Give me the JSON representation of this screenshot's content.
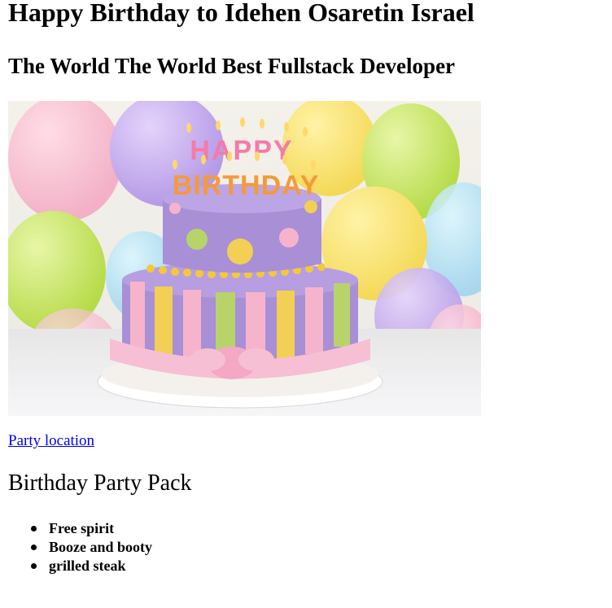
{
  "header": {
    "title": "Happy Birthday to Idehen Osaretin Israel",
    "subtitle": "The World The World Best Fullstack Developer"
  },
  "hero_image": {
    "cake_text_top": "HAPPY",
    "cake_text_bottom": "BIRTHDAY"
  },
  "links": {
    "party_location": "Party location"
  },
  "pack": {
    "heading": "Birthday Party Pack",
    "items": [
      "Free spirit",
      "Booze and booty",
      "grilled steak"
    ]
  },
  "colors": {
    "link": "#0000ee",
    "cake_purple": "#a98fd6",
    "cake_yellow": "#f2cf55",
    "cake_pink": "#f6b4cc",
    "cake_green": "#b8d36a"
  }
}
